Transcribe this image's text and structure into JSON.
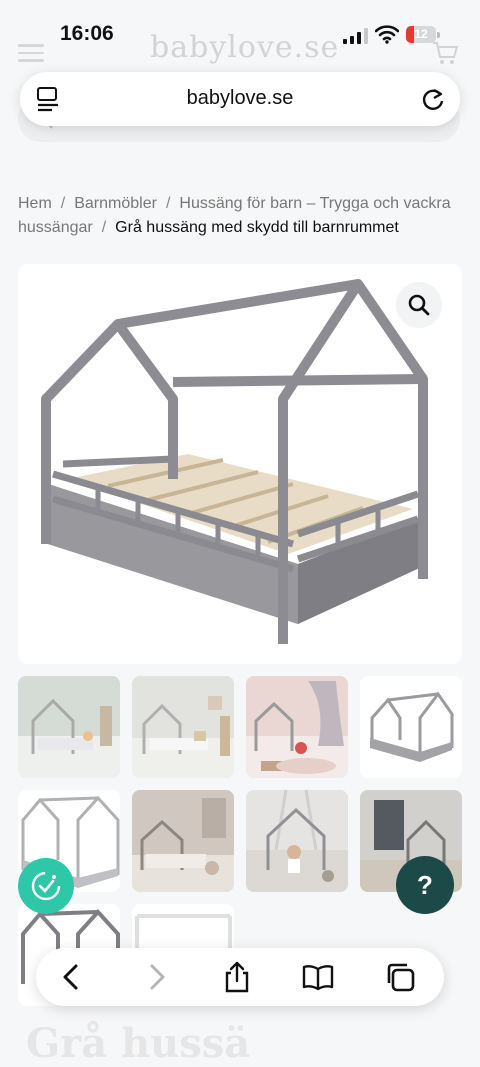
{
  "status_bar": {
    "time": "16:06",
    "battery": "12"
  },
  "site": {
    "logo": "babylove.se"
  },
  "browser": {
    "url": "babylove.se"
  },
  "breadcrumb": {
    "items": [
      "Hem",
      "Barnmöbler",
      "Hussäng för barn – Trygga och vackra hussängar"
    ],
    "separator": "/",
    "current": "Grå hussäng med skydd till barnrummet"
  },
  "product": {
    "main_image": "grey-house-bed-with-rails",
    "thumbnails": [
      "room-with-house-bed-mint",
      "room-with-house-bed-light",
      "pink-room-with-child",
      "house-bed-grey-product",
      "house-bed-outline",
      "house-bed-cozy-room",
      "house-bed-child-playing",
      "house-bed-dark-room",
      "house-bed-grey-outline",
      "house-bed-white"
    ],
    "title_partial": "Grå hussä"
  },
  "widgets": {
    "help_label": "?"
  },
  "colors": {
    "help_button": "#1c4a48",
    "accessibility_button": "#2ec7a8",
    "battery_low": "#e53935"
  }
}
